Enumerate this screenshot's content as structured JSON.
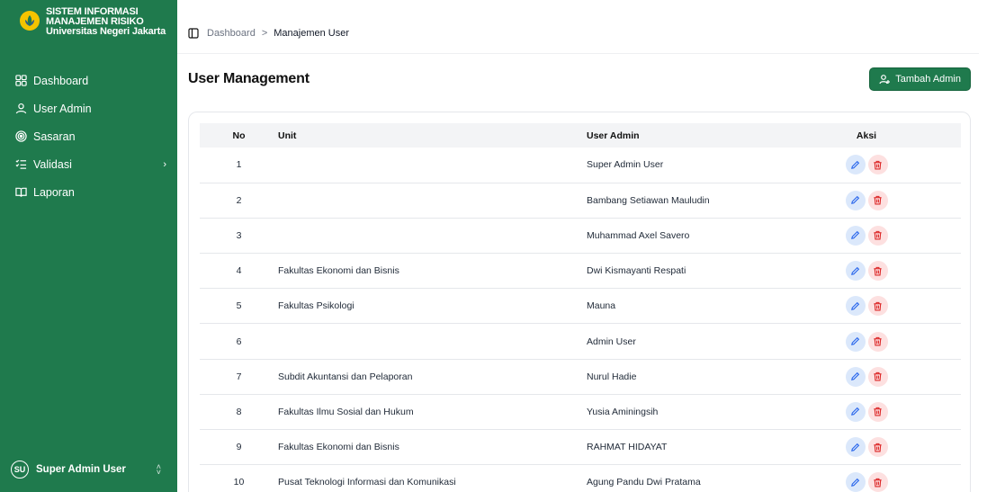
{
  "brand": {
    "line1": "SISTEM INFORMASI",
    "line2": "MANAJEMEN RISIKO",
    "line3": "Universitas Negeri Jakarta"
  },
  "sidebar": {
    "items": [
      {
        "label": "Dashboard",
        "icon": "grid-icon"
      },
      {
        "label": "User Admin",
        "icon": "user-icon"
      },
      {
        "label": "Sasaran",
        "icon": "target-icon"
      },
      {
        "label": "Validasi",
        "icon": "list-check-icon",
        "has_submenu": true
      },
      {
        "label": "Laporan",
        "icon": "book-icon"
      }
    ],
    "user": {
      "initials": "SU",
      "name": "Super Admin User"
    }
  },
  "breadcrumb": {
    "parent": "Dashboard",
    "separator": ">",
    "current": "Manajemen User"
  },
  "page": {
    "title": "User Management",
    "add_button": "Tambah Admin"
  },
  "table": {
    "headers": {
      "no": "No",
      "unit": "Unit",
      "admin": "User Admin",
      "aksi": "Aksi"
    },
    "rows": [
      {
        "no": "1",
        "unit": "",
        "admin": "Super Admin User"
      },
      {
        "no": "2",
        "unit": "",
        "admin": "Bambang Setiawan Mauludin"
      },
      {
        "no": "3",
        "unit": "",
        "admin": "Muhammad Axel Savero"
      },
      {
        "no": "4",
        "unit": "Fakultas Ekonomi dan Bisnis",
        "admin": "Dwi Kismayanti Respati"
      },
      {
        "no": "5",
        "unit": "Fakultas Psikologi",
        "admin": "Mauna"
      },
      {
        "no": "6",
        "unit": "",
        "admin": "Admin User"
      },
      {
        "no": "7",
        "unit": "Subdit Akuntansi dan Pelaporan",
        "admin": "Nurul Hadie"
      },
      {
        "no": "8",
        "unit": "Fakultas Ilmu Sosial dan Hukum",
        "admin": "Yusia Aminingsih"
      },
      {
        "no": "9",
        "unit": "Fakultas Ekonomi dan Bisnis",
        "admin": "RAHMAT HIDAYAT"
      },
      {
        "no": "10",
        "unit": "Pusat Teknologi Informasi dan Komunikasi",
        "admin": "Agung Pandu Dwi Pratama"
      }
    ]
  },
  "colors": {
    "primary": "#1f7a4d",
    "edit_bg": "#dbe8fb",
    "edit_fg": "#2563eb",
    "delete_bg": "#fde0e0",
    "delete_fg": "#dc2626"
  }
}
